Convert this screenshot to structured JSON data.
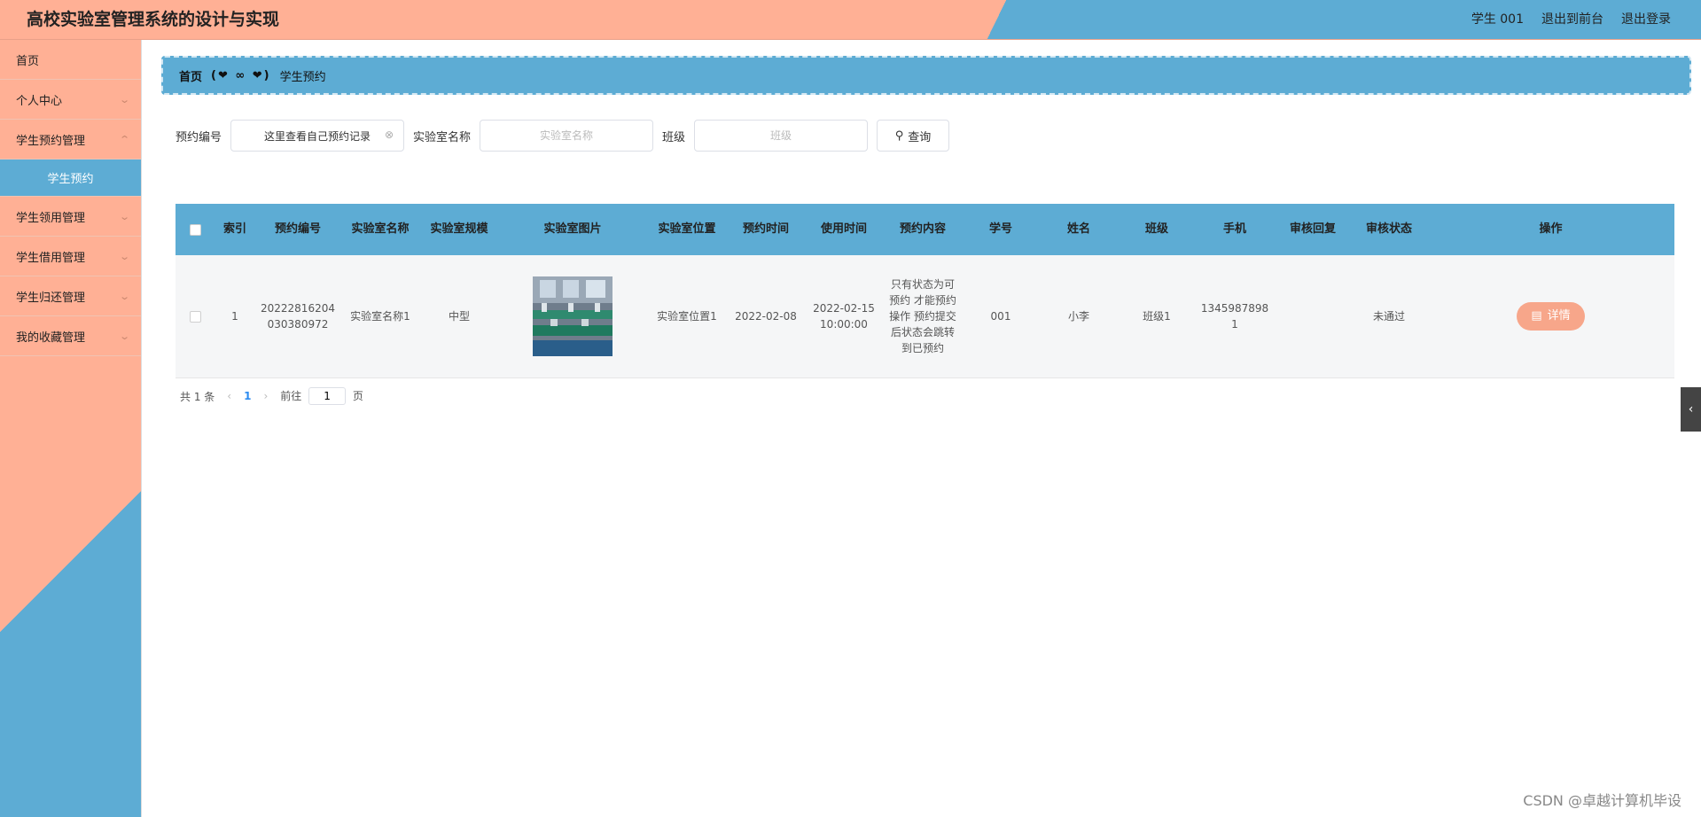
{
  "header": {
    "title": "高校实验室管理系统的设计与实现",
    "user": "学生 001",
    "to_front": "退出到前台",
    "logout": "退出登录"
  },
  "sidebar": {
    "items": [
      {
        "label": "首页",
        "chevron": false
      },
      {
        "label": "个人中心",
        "chevron": true
      },
      {
        "label": "学生预约管理",
        "chevron": true
      },
      {
        "label": "学生预约",
        "sub": true
      },
      {
        "label": "学生领用管理",
        "chevron": true
      },
      {
        "label": "学生借用管理",
        "chevron": true
      },
      {
        "label": "学生归还管理",
        "chevron": true
      },
      {
        "label": "我的收藏管理",
        "chevron": true
      }
    ]
  },
  "breadcrumb": {
    "home": "首页",
    "separator": "(❤ ∞ ❤)",
    "current": "学生预约"
  },
  "search": {
    "field1_label": "预约编号",
    "field1_value": "这里查看自己预约记录",
    "field2_label": "实验室名称",
    "field2_placeholder": "实验室名称",
    "field3_label": "班级",
    "field3_placeholder": "班级",
    "query_label": "查询"
  },
  "table": {
    "headers": [
      "",
      "索引",
      "预约编号",
      "实验室名称",
      "实验室规模",
      "实验室图片",
      "实验室位置",
      "预约时间",
      "使用时间",
      "预约内容",
      "学号",
      "姓名",
      "班级",
      "手机",
      "审核回复",
      "审核状态",
      "操作"
    ],
    "rows": [
      {
        "index": "1",
        "booking_no": "20222816204030380972",
        "lab_name": "实验室名称1",
        "lab_scale": "中型",
        "lab_location": "实验室位置1",
        "booking_time": "2022-02-08",
        "use_time": "2022-02-15 10:00:00",
        "content": "只有状态为可预约 才能预约操作 预约提交后状态会跳转到已预约",
        "student_no": "001",
        "name": "小李",
        "class": "班级1",
        "phone": "13459878981",
        "reply": "",
        "status": "未通过",
        "action": "详情"
      }
    ]
  },
  "pagination": {
    "total": "共 1 条",
    "current_page": "1",
    "goto_label": "前往",
    "goto_value": "1",
    "page_suffix": "页"
  },
  "watermark": "CSDN @卓越计算机毕设",
  "colors": {
    "salmon": "#ffb095",
    "blue": "#5dacd4",
    "button": "#f7a68a"
  }
}
